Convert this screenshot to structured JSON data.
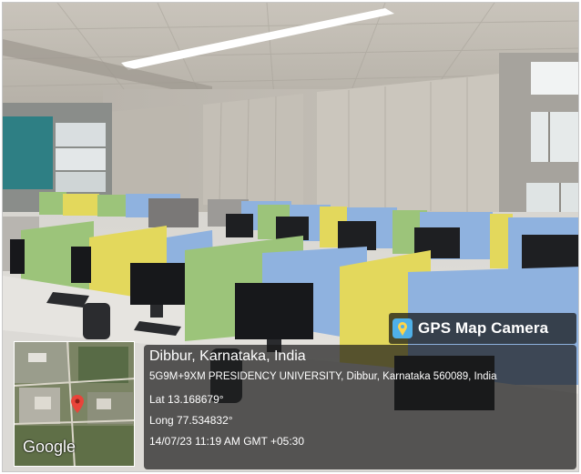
{
  "overlay": {
    "app_badge": "GPS Map Camera",
    "location_title": "Dibbur, Karnataka, India",
    "address": "5G9M+9XM PRESIDENCY UNIVERSITY, Dibbur, Karnataka 560089, India",
    "latitude": "Lat 13.168679°",
    "longitude": "Long 77.534832°",
    "datetime": "14/07/23 11:19 AM GMT +05:30",
    "map_brand": "Google"
  },
  "icons": [
    "map-pin-icon",
    "gps-camera-icon"
  ],
  "colors": {
    "partition_blue": "#8fb2df",
    "partition_green": "#9cc47a",
    "partition_yellow": "#e3d85c",
    "panel_bg": "#1c1c1c",
    "map_pin": "#e8443a"
  }
}
